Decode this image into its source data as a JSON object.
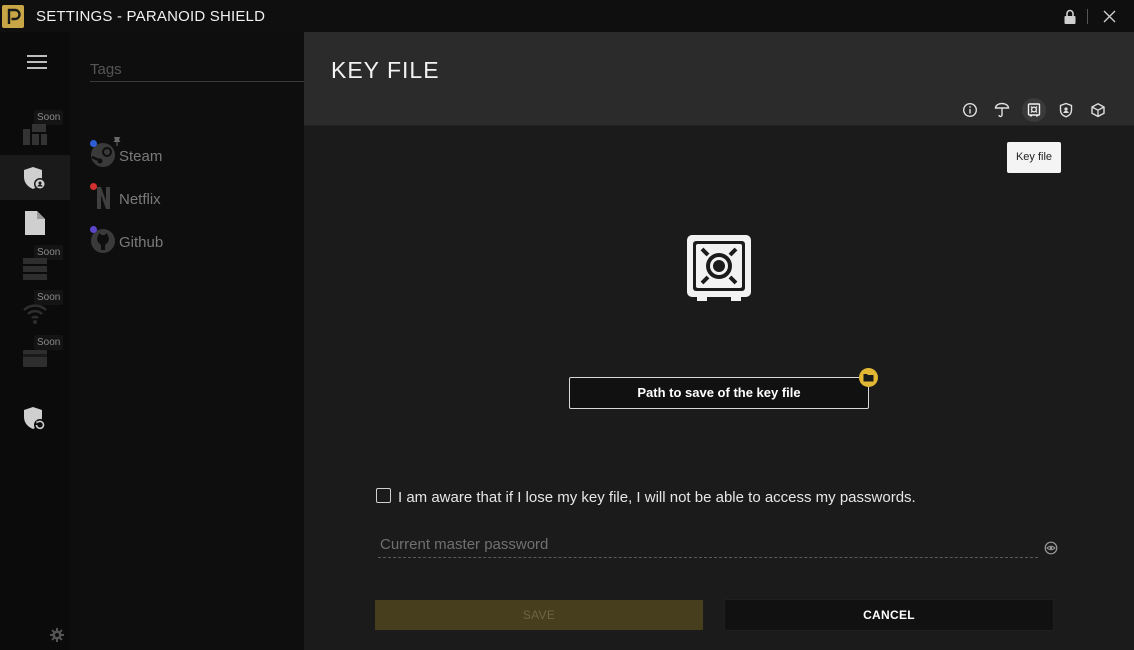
{
  "window": {
    "title": "SETTINGS - PARANOID SHIELD"
  },
  "rail": {
    "soon_label": "Soon"
  },
  "list": {
    "tags_placeholder": "Tags",
    "entries": [
      {
        "name": "Steam",
        "dot_color": "#2f5fd6"
      },
      {
        "name": "Netflix",
        "dot_color": "#d33030"
      },
      {
        "name": "Github",
        "dot_color": "#5a46c8"
      }
    ]
  },
  "main": {
    "title": "KEY FILE",
    "tooltip": "Key file",
    "path_button_label": "Path to save of the key file",
    "aware_text": "I am aware that if I lose my key file, I will not be able to access my passwords.",
    "password_placeholder": "Current master password",
    "save_label": "SAVE",
    "cancel_label": "CANCEL"
  },
  "colors": {
    "accent": "#e1b733",
    "logo": "#c9a645",
    "save_disabled_bg": "#473e1d"
  }
}
